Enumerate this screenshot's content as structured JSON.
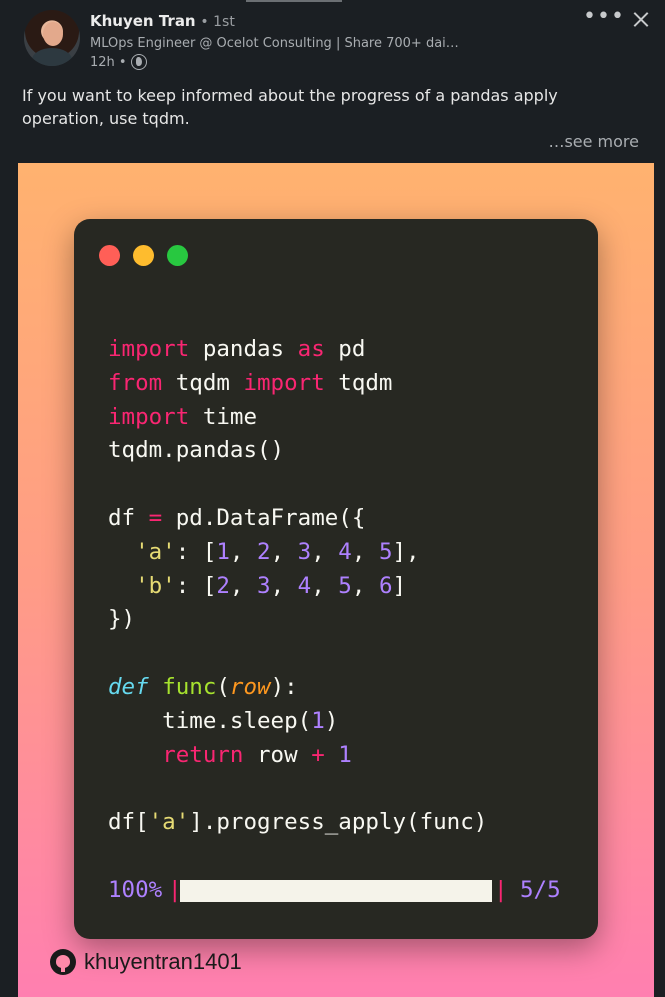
{
  "post": {
    "author": {
      "name": "Khuyen Tran",
      "degree": "• 1st",
      "headline": "MLOps Engineer @ Ocelot Consulting | Share 700+ dai…",
      "time": "12h •"
    },
    "menu": {
      "more_label": "•••"
    },
    "text": "If you want to keep informed about the progress of a pandas apply operation, use tqdm.",
    "see_more": "…see more"
  },
  "image": {
    "code_lines": [
      "import pandas as pd",
      "from tqdm import tqdm",
      "import time",
      "tqdm.pandas()",
      "",
      "df = pd.DataFrame({",
      "  'a': [1, 2, 3, 4, 5],",
      "  'b': [2, 3, 4, 5, 6]",
      "})",
      "",
      "def func(row):",
      "    time.sleep(1)",
      "    return row + 1",
      "",
      "df['a'].progress_apply(func)"
    ],
    "progress": {
      "percent_label": "100%",
      "count_label": "5/5",
      "fraction": 1.0
    },
    "github_handle": "khuyentran1401",
    "colors": {
      "bg_top": "#ffb26f",
      "bg_bottom": "#ff7fb0",
      "editor_bg": "#272822"
    }
  }
}
